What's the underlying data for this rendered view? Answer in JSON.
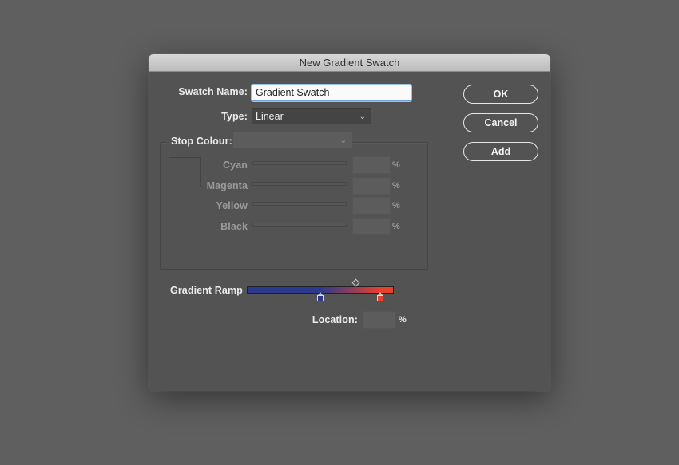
{
  "dialog": {
    "title": "New Gradient Swatch"
  },
  "swatch_name": {
    "label": "Swatch Name:",
    "value": "Gradient Swatch"
  },
  "type": {
    "label": "Type:",
    "selected": "Linear"
  },
  "stop_colour": {
    "label": "Stop Colour:",
    "selected": "",
    "channels": [
      {
        "label": "Cyan",
        "value": "",
        "unit": "%"
      },
      {
        "label": "Magenta",
        "value": "",
        "unit": "%"
      },
      {
        "label": "Yellow",
        "value": "",
        "unit": "%"
      },
      {
        "label": "Black",
        "value": "",
        "unit": "%"
      }
    ]
  },
  "gradient_ramp": {
    "label": "Gradient Ramp",
    "stops": [
      {
        "color": "#2b3a8f",
        "location_percent": 50
      },
      {
        "color": "#e8412a",
        "location_percent": 91
      }
    ],
    "midpoint_percent": 74
  },
  "location": {
    "label": "Location:",
    "value": "",
    "unit": "%"
  },
  "buttons": {
    "ok": "OK",
    "cancel": "Cancel",
    "add": "Add"
  },
  "icons": {
    "chevron": "⌄"
  }
}
